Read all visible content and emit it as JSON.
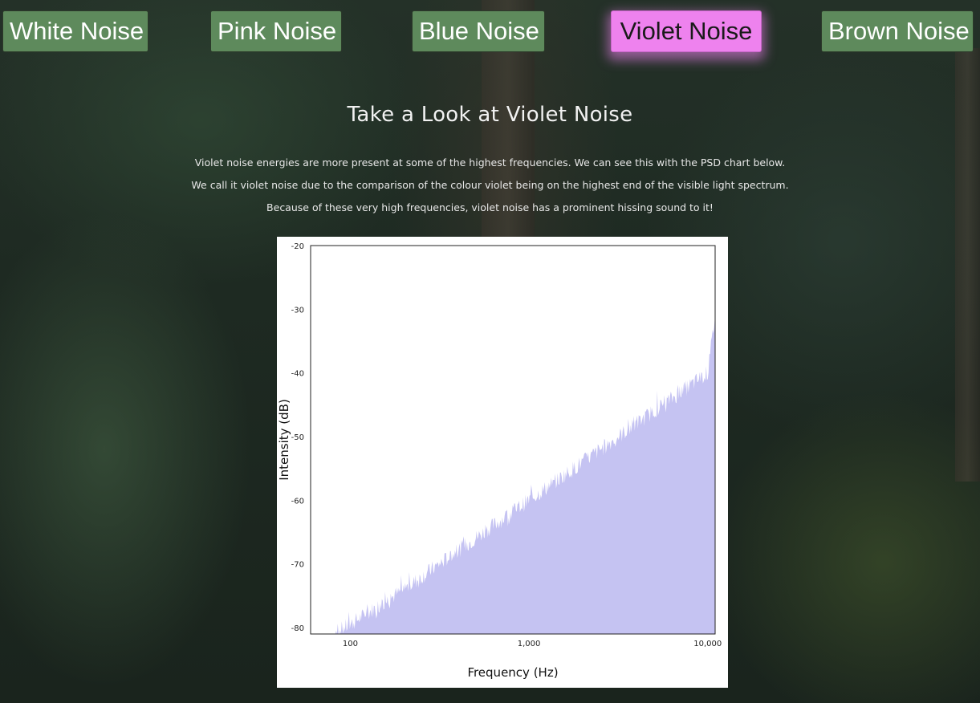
{
  "nav": {
    "buttons": [
      {
        "label": "White Noise",
        "active": false
      },
      {
        "label": "Pink Noise",
        "active": false
      },
      {
        "label": "Blue Noise",
        "active": false
      },
      {
        "label": "Violet Noise",
        "active": true
      },
      {
        "label": "Brown Noise",
        "active": false
      }
    ]
  },
  "main": {
    "title": "Take a Look at Violet Noise",
    "paragraphs": [
      "Violet noise energies are more present at some of the highest frequencies. We can see this with the PSD chart below.",
      "We call it violet noise due to the comparison of the colour violet being on the highest end of the visible light spectrum.",
      "Because of these very high frequencies, violet noise has a prominent hissing sound to it!"
    ]
  },
  "colors": {
    "button_bg": "#5e8a5c",
    "button_active_bg": "#ee82ee",
    "fill": "#c5c3f2"
  },
  "chart_data": {
    "type": "area",
    "xlabel": "Frequency (Hz)",
    "ylabel": "Intensity (dB)",
    "x_scale": "log",
    "xlim": [
      60,
      11000
    ],
    "ylim": [
      -81,
      -20
    ],
    "x_ticks": [
      100,
      1000,
      10000
    ],
    "x_tick_labels": [
      "100",
      "1,000",
      "10,000"
    ],
    "y_ticks": [
      -20,
      -30,
      -40,
      -50,
      -60,
      -70,
      -80
    ],
    "y_tick_labels": [
      "-20",
      "-30",
      "-40",
      "-50",
      "-60",
      "-70",
      "-80"
    ],
    "x": [
      80,
      100,
      200,
      500,
      1000,
      2000,
      5000,
      10000,
      11000
    ],
    "y": [
      -81,
      -79.5,
      -74,
      -66,
      -60,
      -54,
      -46,
      -40,
      -31
    ],
    "grid": false,
    "legend": "none"
  }
}
